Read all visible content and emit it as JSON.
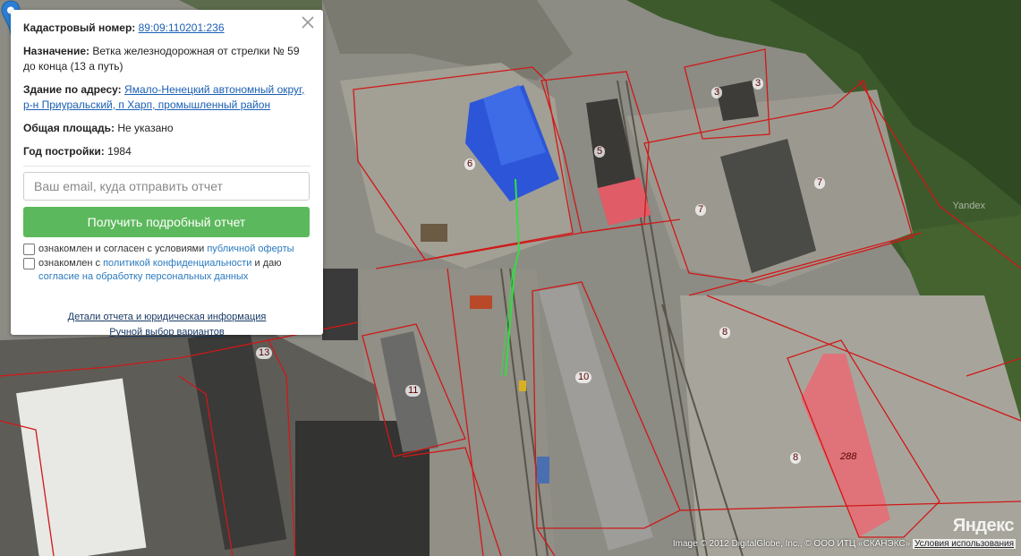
{
  "popup": {
    "cadastral_label": "Кадастровый номер:",
    "cadastral_value": "89:09:110201:236",
    "purpose_label": "Назначение:",
    "purpose_value": "Ветка железнодорожная от стрелки № 59 до конца (13 а путь)",
    "address_label": "Здание по адресу:",
    "address_value": "Ямало-Ненецкий автономный округ, р-н Приуральский, п Харп, промышленный район",
    "area_label": "Общая площадь:",
    "area_value": "Не указано",
    "year_label": "Год постройки:",
    "year_value": "1984",
    "email_placeholder": "Ваш email, куда отправить отчет",
    "report_button": "Получить подробный отчет",
    "consent1_text": "ознакомлен и согласен с условиями",
    "consent1_link": "публичной оферты",
    "consent2_text": "ознакомлен с",
    "consent2_link": "политикой конфиденциальности",
    "consent2_mid": "и даю",
    "consent2_link2": "согласие на обработку персональных данных",
    "details_link": "Детали отчета и юридическая информация",
    "manual_link": "Ручной выбор вариантов"
  },
  "map": {
    "plot_labels": [
      "3",
      "3",
      "5",
      "6",
      "7",
      "7",
      "8",
      "8",
      "10",
      "11",
      "13",
      "288"
    ],
    "watermark": "Yandex",
    "logo": "Яндекс",
    "copyright": "Image © 2012 DigitalGlobe, Inc., © ООО ИТЦ «СКАНЭКС»",
    "terms_link": "Условия использования",
    "colors": {
      "boundary": "#d01818",
      "route": "#33dd44",
      "pin": "#2a7fd4",
      "blue_roof": "#2d55d8",
      "red_roof": "#e0737a",
      "button": "#5cb85c"
    }
  }
}
